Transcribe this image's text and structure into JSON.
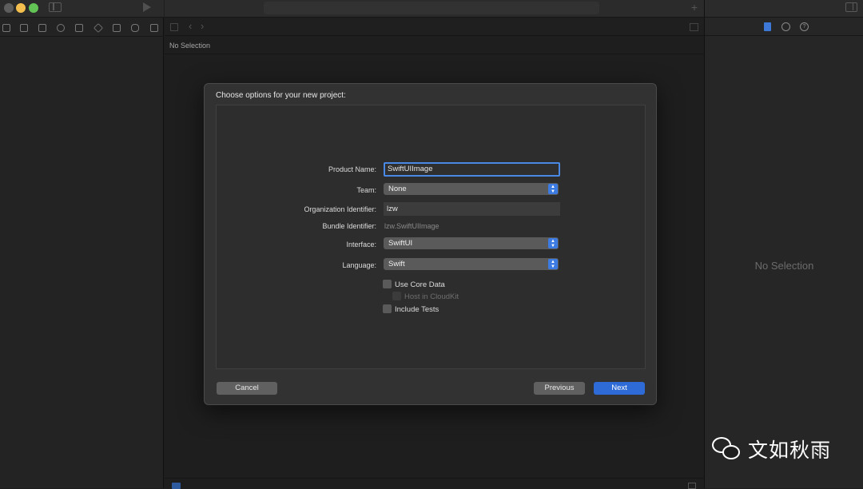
{
  "left_panel": {
    "traffic_lights": [
      "close",
      "minimize",
      "zoom"
    ],
    "nav_icons": [
      "folder-icon",
      "source-control-icon",
      "hierarchy-icon",
      "search-icon",
      "warning-icon",
      "test-icon",
      "debug-icon",
      "breakpoint-icon",
      "report-icon"
    ]
  },
  "editor": {
    "path_label": "No Selection"
  },
  "inspector": {
    "empty_label": "No Selection"
  },
  "dialog": {
    "title": "Choose options for your new project:",
    "fields": {
      "product_name": {
        "label": "Product Name:",
        "value": "SwiftUIImage"
      },
      "team": {
        "label": "Team:",
        "value": "None"
      },
      "organization_identifier": {
        "label": "Organization Identifier:",
        "value": "lzw"
      },
      "bundle_identifier": {
        "label": "Bundle Identifier:",
        "value": "lzw.SwiftUIImage"
      },
      "interface": {
        "label": "Interface:",
        "value": "SwiftUI"
      },
      "language": {
        "label": "Language:",
        "value": "Swift"
      }
    },
    "checkboxes": {
      "use_core_data": {
        "label": "Use Core Data",
        "checked": false
      },
      "host_in_cloudkit": {
        "label": "Host in CloudKit",
        "checked": false,
        "enabled": false
      },
      "include_tests": {
        "label": "Include Tests",
        "checked": false
      }
    },
    "buttons": {
      "cancel": "Cancel",
      "previous": "Previous",
      "next": "Next"
    }
  },
  "watermark": {
    "text": "文如秋雨"
  },
  "colors": {
    "accent": "#2f6bd6",
    "focus_ring": "#4a88e6",
    "window_bg": "#1e1e1e",
    "dialog_bg": "#323232"
  }
}
